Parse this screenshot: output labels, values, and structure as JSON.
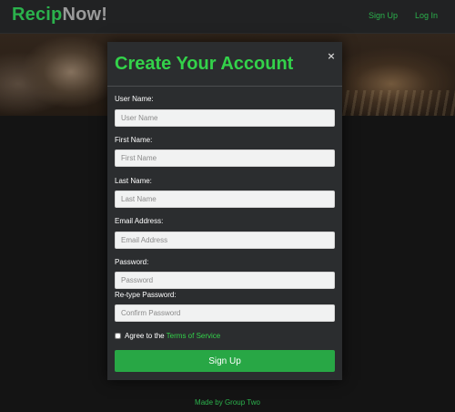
{
  "navbar": {
    "brand_part1": "Recip",
    "brand_part2": "Now!",
    "links": [
      "Sign Up",
      "Log In"
    ]
  },
  "modal": {
    "title": "Create Your Account",
    "close_symbol": "×",
    "fields": [
      {
        "label": "User Name:",
        "placeholder": "User Name",
        "value": ""
      },
      {
        "label": "First Name:",
        "placeholder": "First Name",
        "value": ""
      },
      {
        "label": "Last Name:",
        "placeholder": "Last Name",
        "value": ""
      },
      {
        "label": "Email Address:",
        "placeholder": "Email Address",
        "value": ""
      },
      {
        "label": "Password:",
        "placeholder": "Password",
        "value": ""
      },
      {
        "label": "Re-type Password:",
        "placeholder": "Confirm Password",
        "value": ""
      }
    ],
    "terms": {
      "prefix": "Agree to the",
      "link": "Terms of Service",
      "checked": false
    },
    "submit_label": "Sign Up"
  },
  "footer": {
    "text": "Made by Group Two"
  },
  "colors": {
    "accent": "#2bb24c",
    "button": "#28a745",
    "navbar_bg": "#212223",
    "modal_bg": "#2b2d2f",
    "page_bg": "#141414"
  }
}
